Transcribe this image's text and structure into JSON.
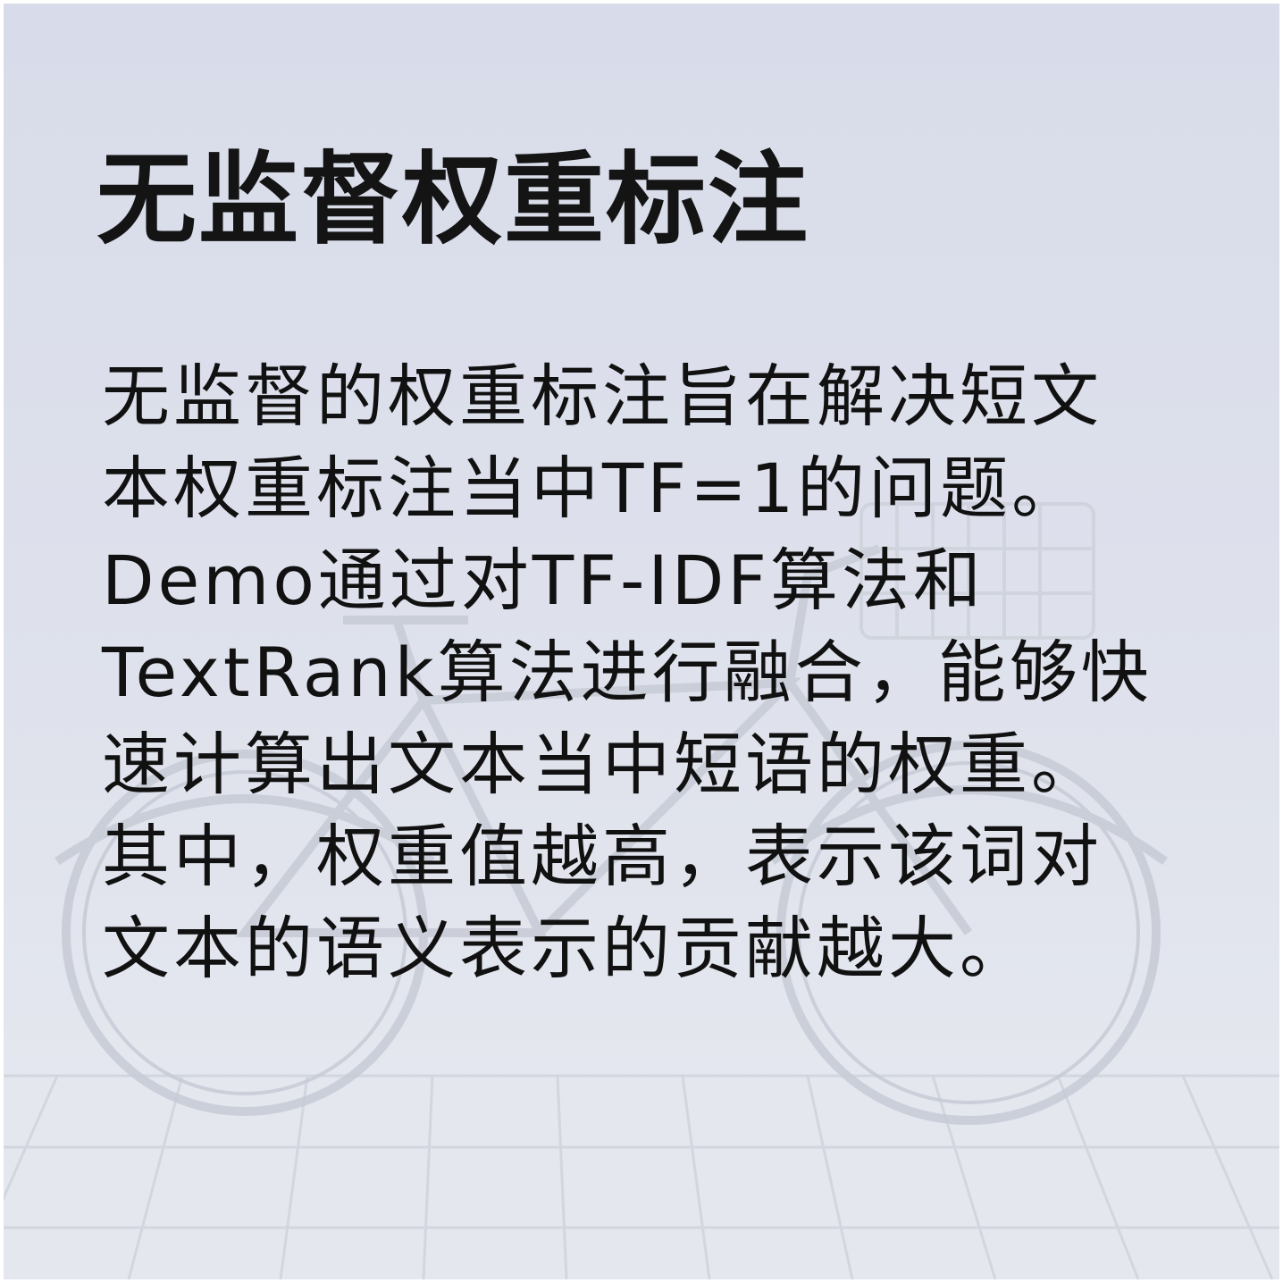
{
  "title": "无监督权重标注",
  "body": {
    "lines": [
      "无监督的权重标注旨在解决短文",
      "本权重标注当中TF=1的问题。",
      "Demo通过对TF-IDF算法和",
      "TextRank算法进行融合，能够快",
      "速计算出文本当中短语的权重。",
      "其中，权重值越高，表示该词对",
      "文本的语义表示的贡献越大。"
    ]
  },
  "colors": {
    "background": "#dcdfea",
    "text": "#111111",
    "watermark": "#c4c8d3"
  },
  "background_image": "faded-bicycle-on-wooden-floor"
}
